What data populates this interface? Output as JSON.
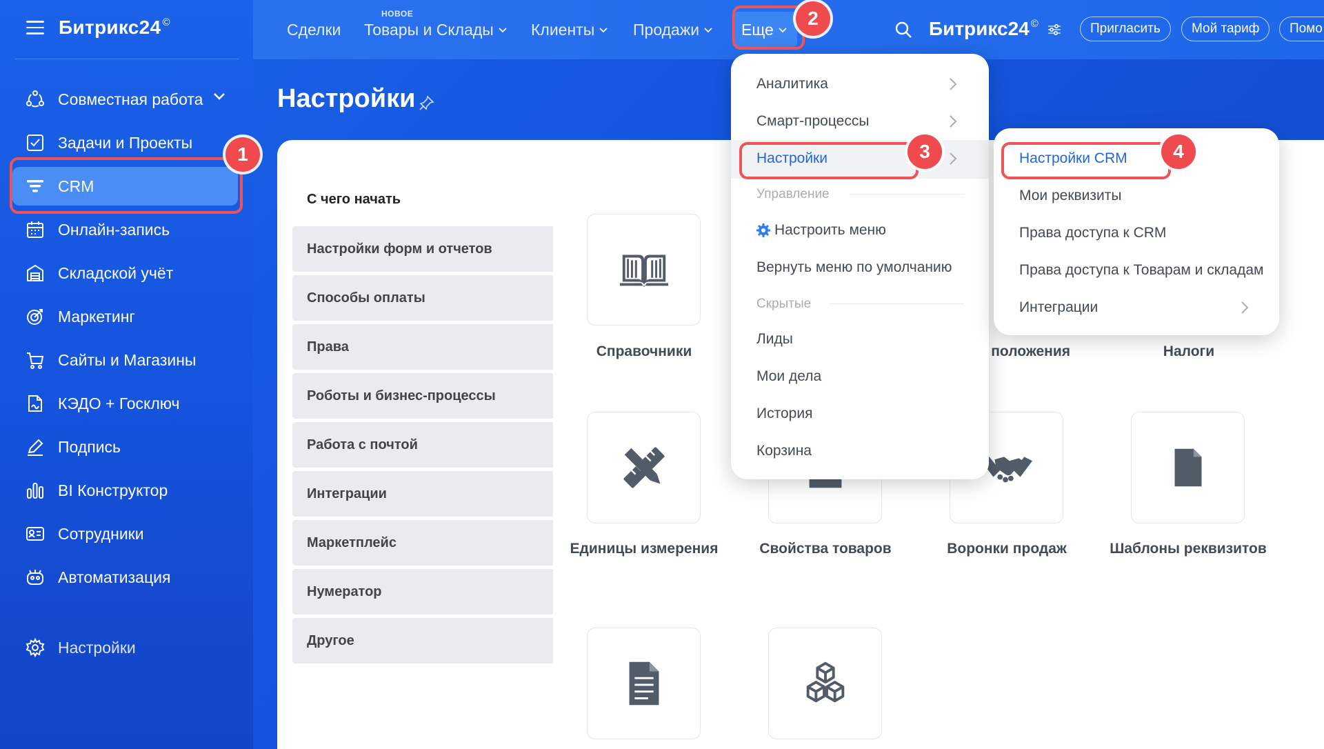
{
  "sidebar": {
    "logo": "Битрикс24",
    "logo_sup": "©",
    "items": [
      {
        "label": "Совместная работа"
      },
      {
        "label": "Задачи и Проекты"
      },
      {
        "label": "CRM"
      },
      {
        "label": "Онлайн-запись"
      },
      {
        "label": "Складской учёт"
      },
      {
        "label": "Маркетинг"
      },
      {
        "label": "Сайты и Магазины"
      },
      {
        "label": "КЭДО + Госключ"
      },
      {
        "label": "Подпись"
      },
      {
        "label": "BI Конструктор"
      },
      {
        "label": "Сотрудники"
      },
      {
        "label": "Автоматизация"
      }
    ],
    "settings_label": "Настройки"
  },
  "topbar": {
    "links": [
      "Сделки",
      "Товары и Склады",
      "Клиенты",
      "Продажи"
    ],
    "new_label": "НОВОЕ",
    "more_label": "Еще",
    "logo": "Битрикс24",
    "logo_sup": "©",
    "invite": "Пригласить",
    "tariff": "Мой тариф",
    "help": "Помо"
  },
  "page": {
    "title": "Настройки",
    "start_label": "С чего начать",
    "left_menu": [
      "Настройки форм и отчетов",
      "Способы оплаты",
      "Права",
      "Роботы и бизнес-процессы",
      "Работа с почтой",
      "Интеграции",
      "Маркетплейс",
      "Нумератор",
      "Другое"
    ],
    "tiles": [
      {
        "label": "Справочники"
      },
      {
        "label": "положения"
      },
      {
        "label": "Налоги"
      },
      {
        "label": "Единицы измерения"
      },
      {
        "label": "Свойства товаров"
      },
      {
        "label": "Воронки продаж"
      },
      {
        "label": "Шаблоны реквизитов"
      }
    ]
  },
  "dropdown_more": {
    "items": [
      "Аналитика",
      "Смарт-процессы",
      "Настройки"
    ],
    "section_manage": "Управление",
    "configure_menu": "Настроить меню",
    "reset_menu": "Вернуть меню по умолчанию",
    "section_hidden": "Скрытые",
    "hidden_items": [
      "Лиды",
      "Мои дела",
      "История",
      "Корзина"
    ]
  },
  "dropdown_settings": {
    "items": [
      "Настройки CRM",
      "Мои реквизиты",
      "Права доступа к CRM",
      "Права доступа к Товарам и складам",
      "Интеграции"
    ]
  },
  "badges": [
    "1",
    "2",
    "3",
    "4"
  ],
  "colors": {
    "accent": "#1b62e8",
    "highlight": "#ef4b4f",
    "active_link": "#2066d8"
  }
}
